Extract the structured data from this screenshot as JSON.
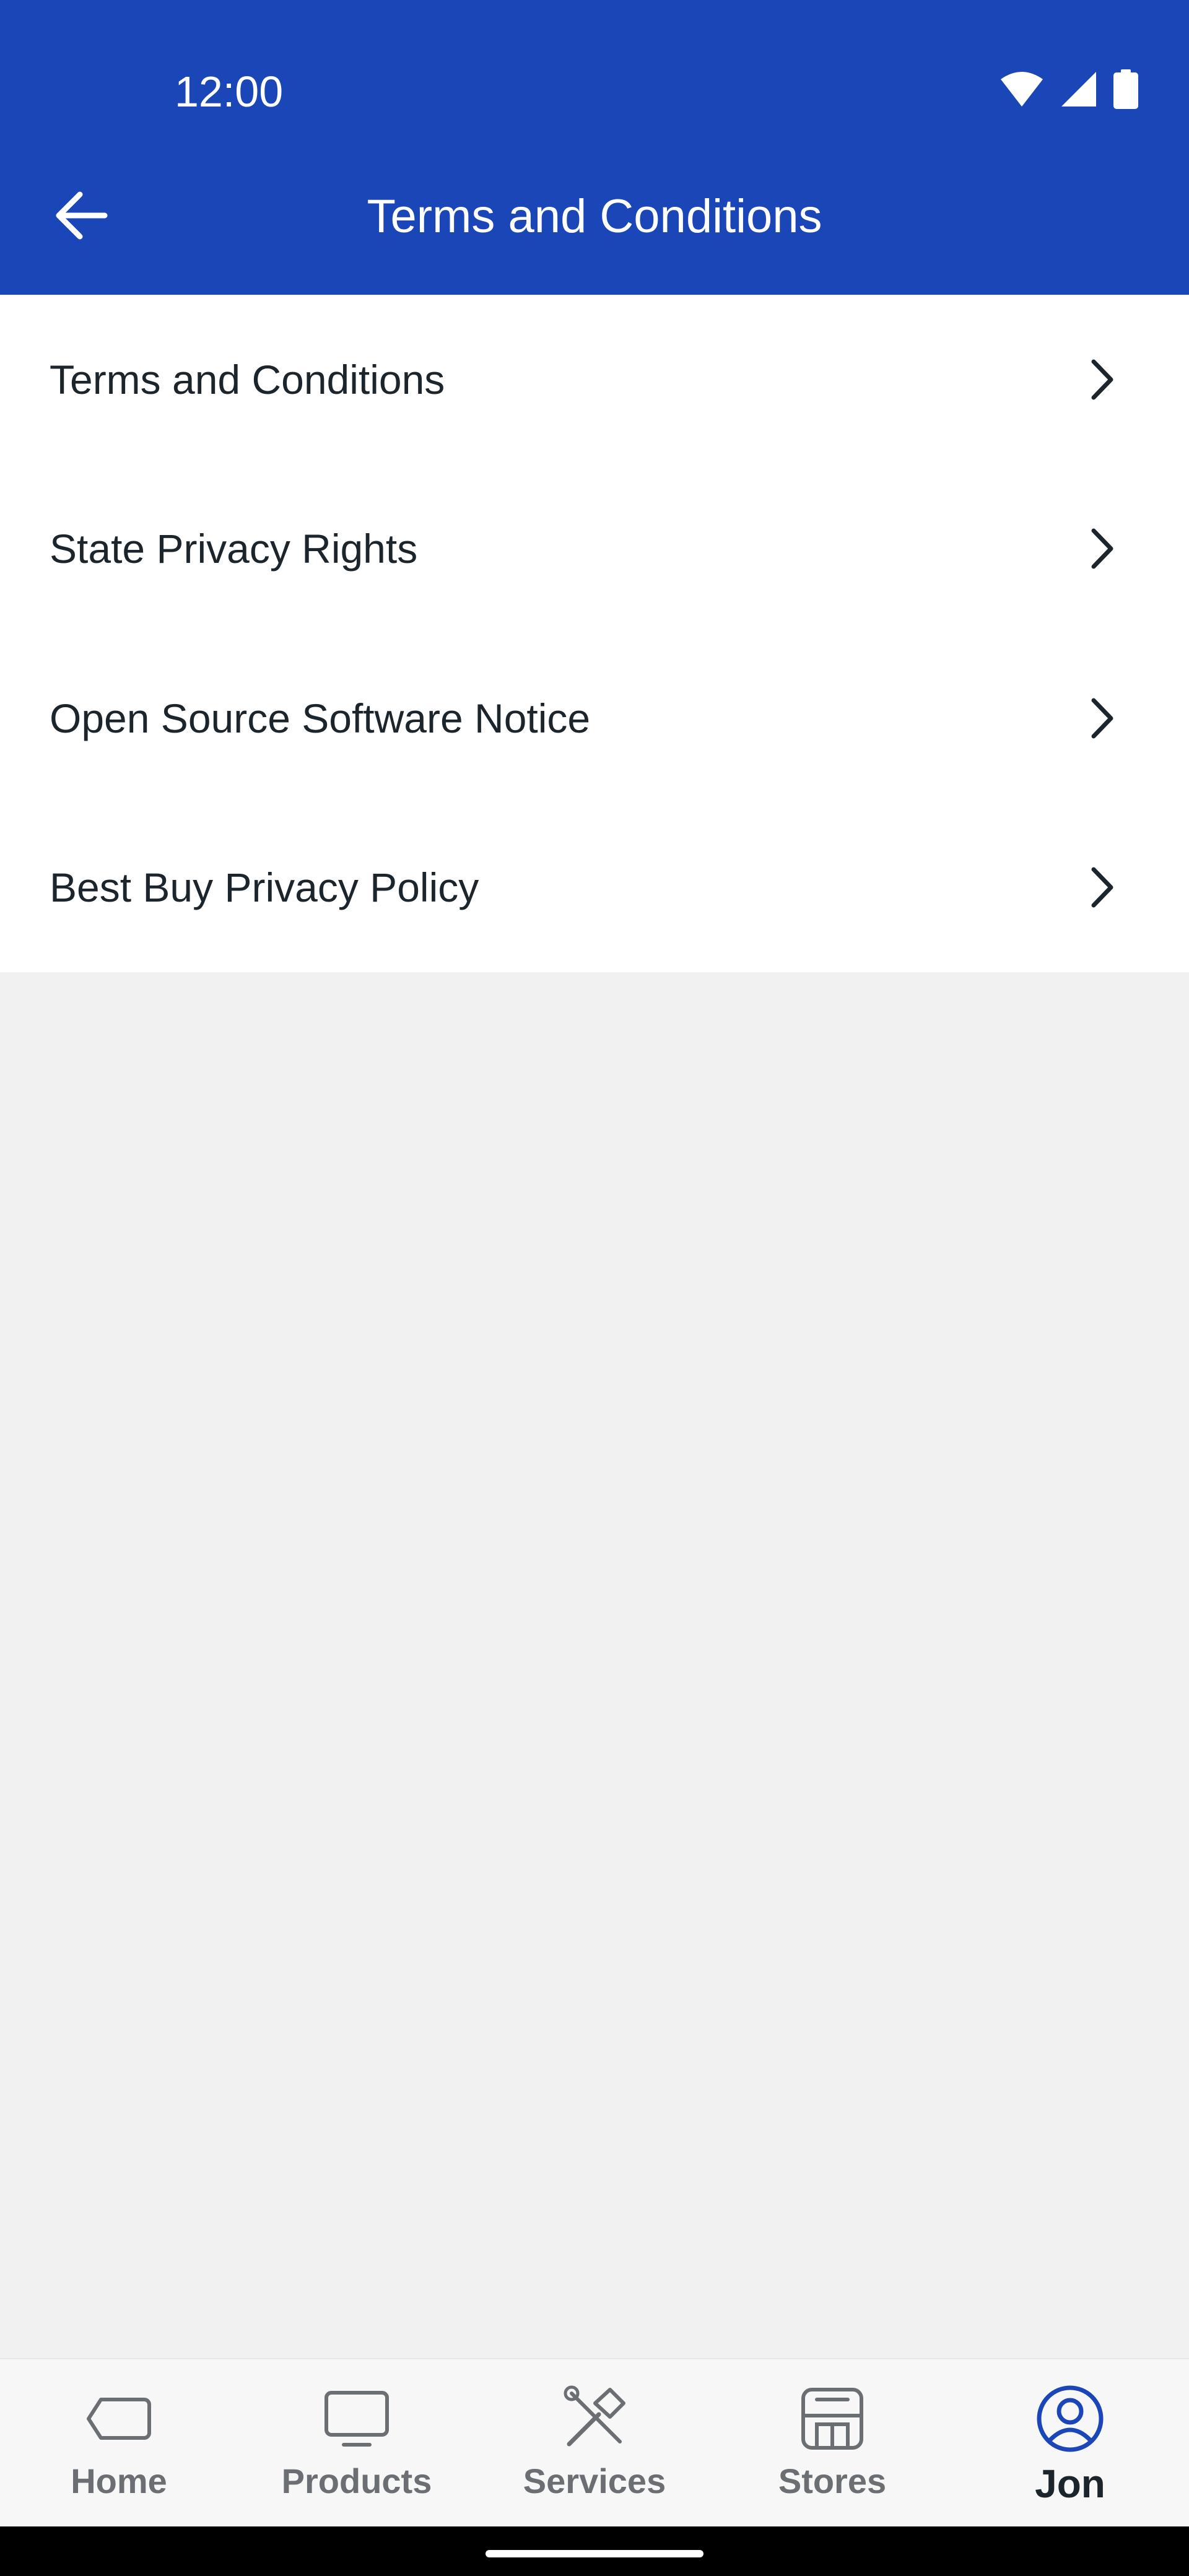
{
  "status_bar": {
    "time": "12:00",
    "icons": [
      "wifi-icon",
      "signal-icon",
      "battery-icon"
    ]
  },
  "header": {
    "title": "Terms and Conditions",
    "back_icon": "arrow-left-icon"
  },
  "list": {
    "items": [
      {
        "label": "Terms and Conditions"
      },
      {
        "label": "State Privacy Rights"
      },
      {
        "label": "Open Source Software Notice"
      },
      {
        "label": "Best Buy Privacy Policy"
      }
    ],
    "chevron_icon": "chevron-right-icon"
  },
  "bottom_nav": {
    "items": [
      {
        "label": "Home",
        "icon": "tag-icon"
      },
      {
        "label": "Products",
        "icon": "monitor-icon"
      },
      {
        "label": "Services",
        "icon": "tools-icon"
      },
      {
        "label": "Stores",
        "icon": "store-icon"
      },
      {
        "label": "Jon",
        "icon": "user-avatar-icon",
        "active": true
      }
    ]
  },
  "colors": {
    "primary": "#1b46b8",
    "text": "#1d252c",
    "nav_inactive": "#6b6f73",
    "background": "#f1f1f1"
  }
}
